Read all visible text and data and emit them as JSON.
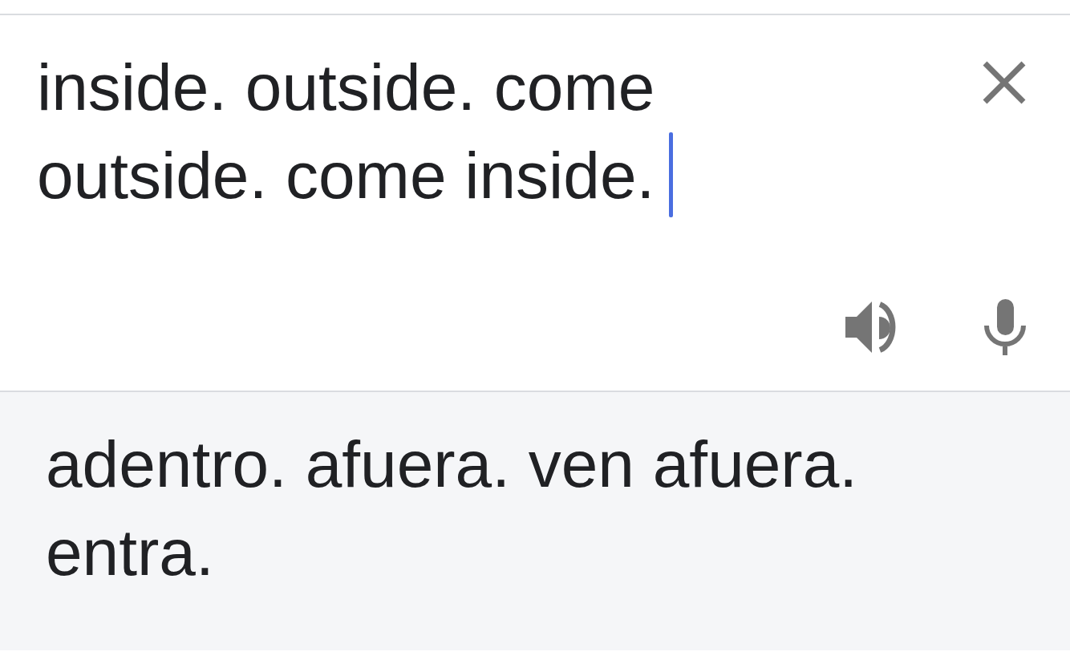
{
  "source": {
    "value": "inside. outside. come outside. come inside.",
    "focused": true
  },
  "translation": {
    "text": "adentro. afuera. ven afuera. entra."
  }
}
